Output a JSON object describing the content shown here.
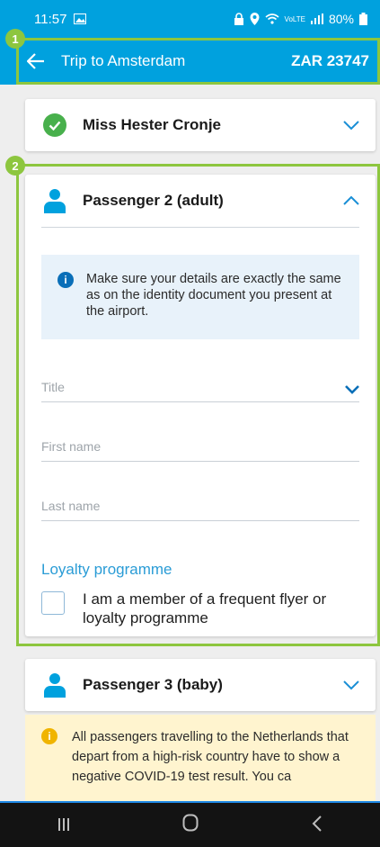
{
  "status_bar": {
    "time": "11:57",
    "network_label": "VoLTE",
    "battery": "80%"
  },
  "app_bar": {
    "title": "Trip to Amsterdam",
    "price": "ZAR 23747"
  },
  "badges": [
    "1",
    "2"
  ],
  "passenger1": {
    "name": "Miss Hester Cronje"
  },
  "passenger2": {
    "title": "Passenger 2 (adult)",
    "info_text": "Make sure your details are exactly the same as on the identity document you present at the airport.",
    "fields": {
      "title_placeholder": "Title",
      "first_name_placeholder": "First name",
      "last_name_placeholder": "Last name"
    },
    "loyalty_heading": "Loyalty programme",
    "loyalty_checkbox_label": "I am a member of a frequent flyer or loyalty programme"
  },
  "passenger3": {
    "title": "Passenger 3 (baby)"
  },
  "notice": {
    "text": "All passengers travelling to the Netherlands that depart from a high-risk country have to show a negative COVID-19 test result. You ca"
  },
  "colors": {
    "brand": "#00a1de",
    "highlight": "#8dc63f",
    "success": "#48b04c",
    "info": "#0a6fb8",
    "warning": "#f0b400"
  },
  "icons": {
    "back": "arrow-left-icon",
    "check": "check-circle-icon",
    "person": "person-icon",
    "chevron_down": "chevron-down-icon",
    "chevron_up": "chevron-up-icon",
    "info": "info-icon",
    "warning": "info-warning-icon"
  }
}
